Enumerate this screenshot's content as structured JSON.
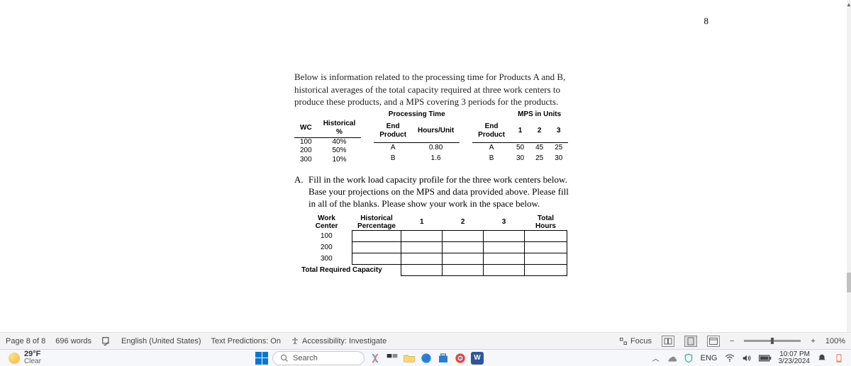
{
  "page_number_top": "8",
  "intro": "Below is information related to the processing time for Products A and B, historical averages of the total capacity required at three work centers to produce these products, and a MPS covering 3 periods for the products.",
  "wc_table": {
    "headers": [
      "WC",
      "Historical %"
    ],
    "rows": [
      {
        "wc": "100",
        "pct": "40%"
      },
      {
        "wc": "200",
        "pct": "50%"
      },
      {
        "wc": "300",
        "pct": "10%"
      }
    ]
  },
  "proc_table": {
    "group": "Processing Time",
    "headers": [
      "End Product",
      "Hours/Unit"
    ],
    "rows": [
      {
        "ep": "A",
        "hu": "0.80"
      },
      {
        "ep": "B",
        "hu": "1.6"
      }
    ]
  },
  "mps_table": {
    "group": "MPS in Units",
    "headers": [
      "End Product",
      "1",
      "2",
      "3"
    ],
    "rows": [
      {
        "ep": "A",
        "p1": "50",
        "p2": "45",
        "p3": "25"
      },
      {
        "ep": "B",
        "p1": "30",
        "p2": "25",
        "p3": "30"
      }
    ]
  },
  "question": {
    "label": "A.",
    "text": "Fill in the work load capacity profile for the three work centers below. Base your projections on the MPS and data provided above. Please fill in all of the blanks. Please show your work in the space below."
  },
  "worksheet": {
    "headers": {
      "wc": "Work Center",
      "hp": "Historical Percentage",
      "p1": "1",
      "p2": "2",
      "p3": "3",
      "tot": "Total Hours"
    },
    "rows": [
      "100",
      "200",
      "300"
    ],
    "footer": "Total Required Capacity"
  },
  "status": {
    "page": "Page 8 of 8",
    "words": "696 words",
    "lang": "English (United States)",
    "predictions": "Text Predictions: On",
    "accessibility": "Accessibility: Investigate",
    "focus": "Focus",
    "zoom": "100%",
    "minus": "−",
    "plus": "+"
  },
  "taskbar": {
    "temp": "29°F",
    "cond": "Clear",
    "search_placeholder": "Search",
    "lang": "ENG",
    "time": "10:07 PM",
    "date": "3/23/2024"
  }
}
